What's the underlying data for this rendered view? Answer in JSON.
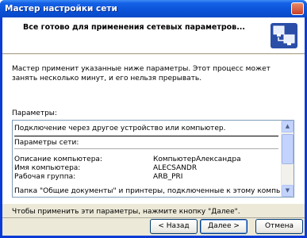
{
  "window": {
    "title": "Мастер настройки сети"
  },
  "header": {
    "title": "Все готово для применения сетевых параметров..."
  },
  "intro": "Мастер применит указанные ниже параметры. Этот процесс может занять несколько минут, и его нельзя прерывать.",
  "params": {
    "label": "Параметры:",
    "connection": "Подключение через другое устройство или компьютер.",
    "network_settings": "Параметры сети:",
    "rows": [
      {
        "key": "Описание компьютера:",
        "value": "КомпьютерАлександра"
      },
      {
        "key": "Имя компьютера:",
        "value": "ALECSANDR"
      },
      {
        "key": "Рабочая группа:",
        "value": "ARB_PRI"
      }
    ],
    "shared_note": "Папка \"Общие документы\" и принтеры, подключенные к этому компьютеру, будут"
  },
  "apply_note": "Чтобы применить эти параметры, нажмите кнопку \"Далее\".",
  "buttons": {
    "back": "< Назад",
    "next": "Далее >",
    "cancel": "Отмена"
  },
  "icons": {
    "header": "network-computers-icon",
    "close": "close-icon",
    "scroll_up": "scroll-up-arrow-icon",
    "scroll_down": "scroll-down-arrow-icon"
  }
}
